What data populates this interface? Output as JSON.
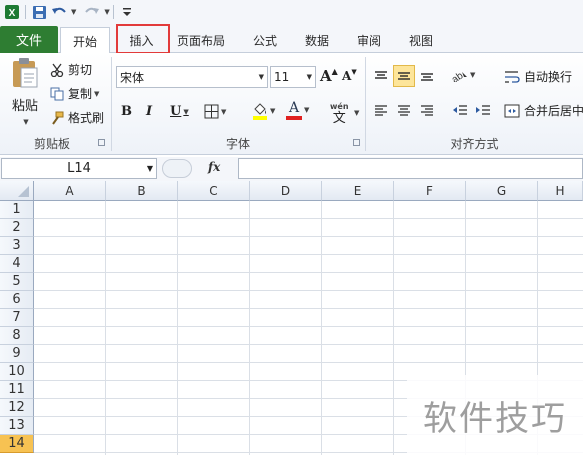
{
  "qat": {
    "items": [
      "excel-logo-icon",
      "save-icon",
      "undo-icon",
      "redo-icon",
      "customize-icon"
    ]
  },
  "tabs": {
    "file": "文件",
    "home": "开始",
    "insert": "插入",
    "page_layout": "页面布局",
    "formulas": "公式",
    "data": "数据",
    "review": "审阅",
    "view": "视图"
  },
  "ribbon": {
    "clipboard": {
      "paste": "粘贴",
      "cut": "剪切",
      "copy": "复制",
      "format_painter": "格式刷",
      "label": "剪贴板"
    },
    "font": {
      "font_name": "宋体",
      "font_size": "11",
      "label": "字体",
      "bold": "B",
      "italic": "I",
      "underline": "U",
      "grow": "A",
      "shrink": "A",
      "font_color_glyph": "A",
      "phonetic": "文"
    },
    "alignment": {
      "wrap_text": "自动换行",
      "merge_center": "合并后居中",
      "label": "对齐方式"
    }
  },
  "formula_bar": {
    "name_box": "L14",
    "fx": "fx",
    "content": ""
  },
  "sheet": {
    "columns": [
      "A",
      "B",
      "C",
      "D",
      "E",
      "F",
      "G",
      "H"
    ],
    "rows": [
      "1",
      "2",
      "3",
      "4",
      "5",
      "6",
      "7",
      "8",
      "9",
      "10",
      "11",
      "12",
      "13",
      "14"
    ],
    "active_row": "14"
  },
  "watermark": "软件技巧",
  "colors": {
    "file_tab": "#2e7d32",
    "highlight_box": "#e23a3a",
    "active_row_header": "#f7c252",
    "active_align_button": "#fde59a"
  }
}
